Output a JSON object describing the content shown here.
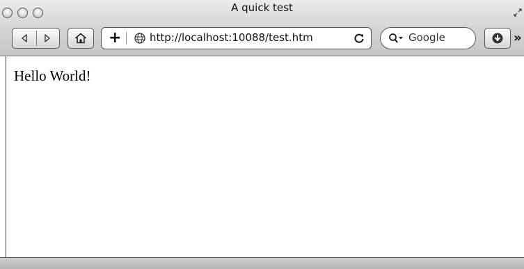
{
  "window": {
    "title": "A quick test"
  },
  "toolbar": {
    "address": "http://localhost:10088/test.htm",
    "add_label": "+",
    "search_placeholder": "Google",
    "overflow_label": "»"
  },
  "page": {
    "content_text": "Hello World!"
  }
}
